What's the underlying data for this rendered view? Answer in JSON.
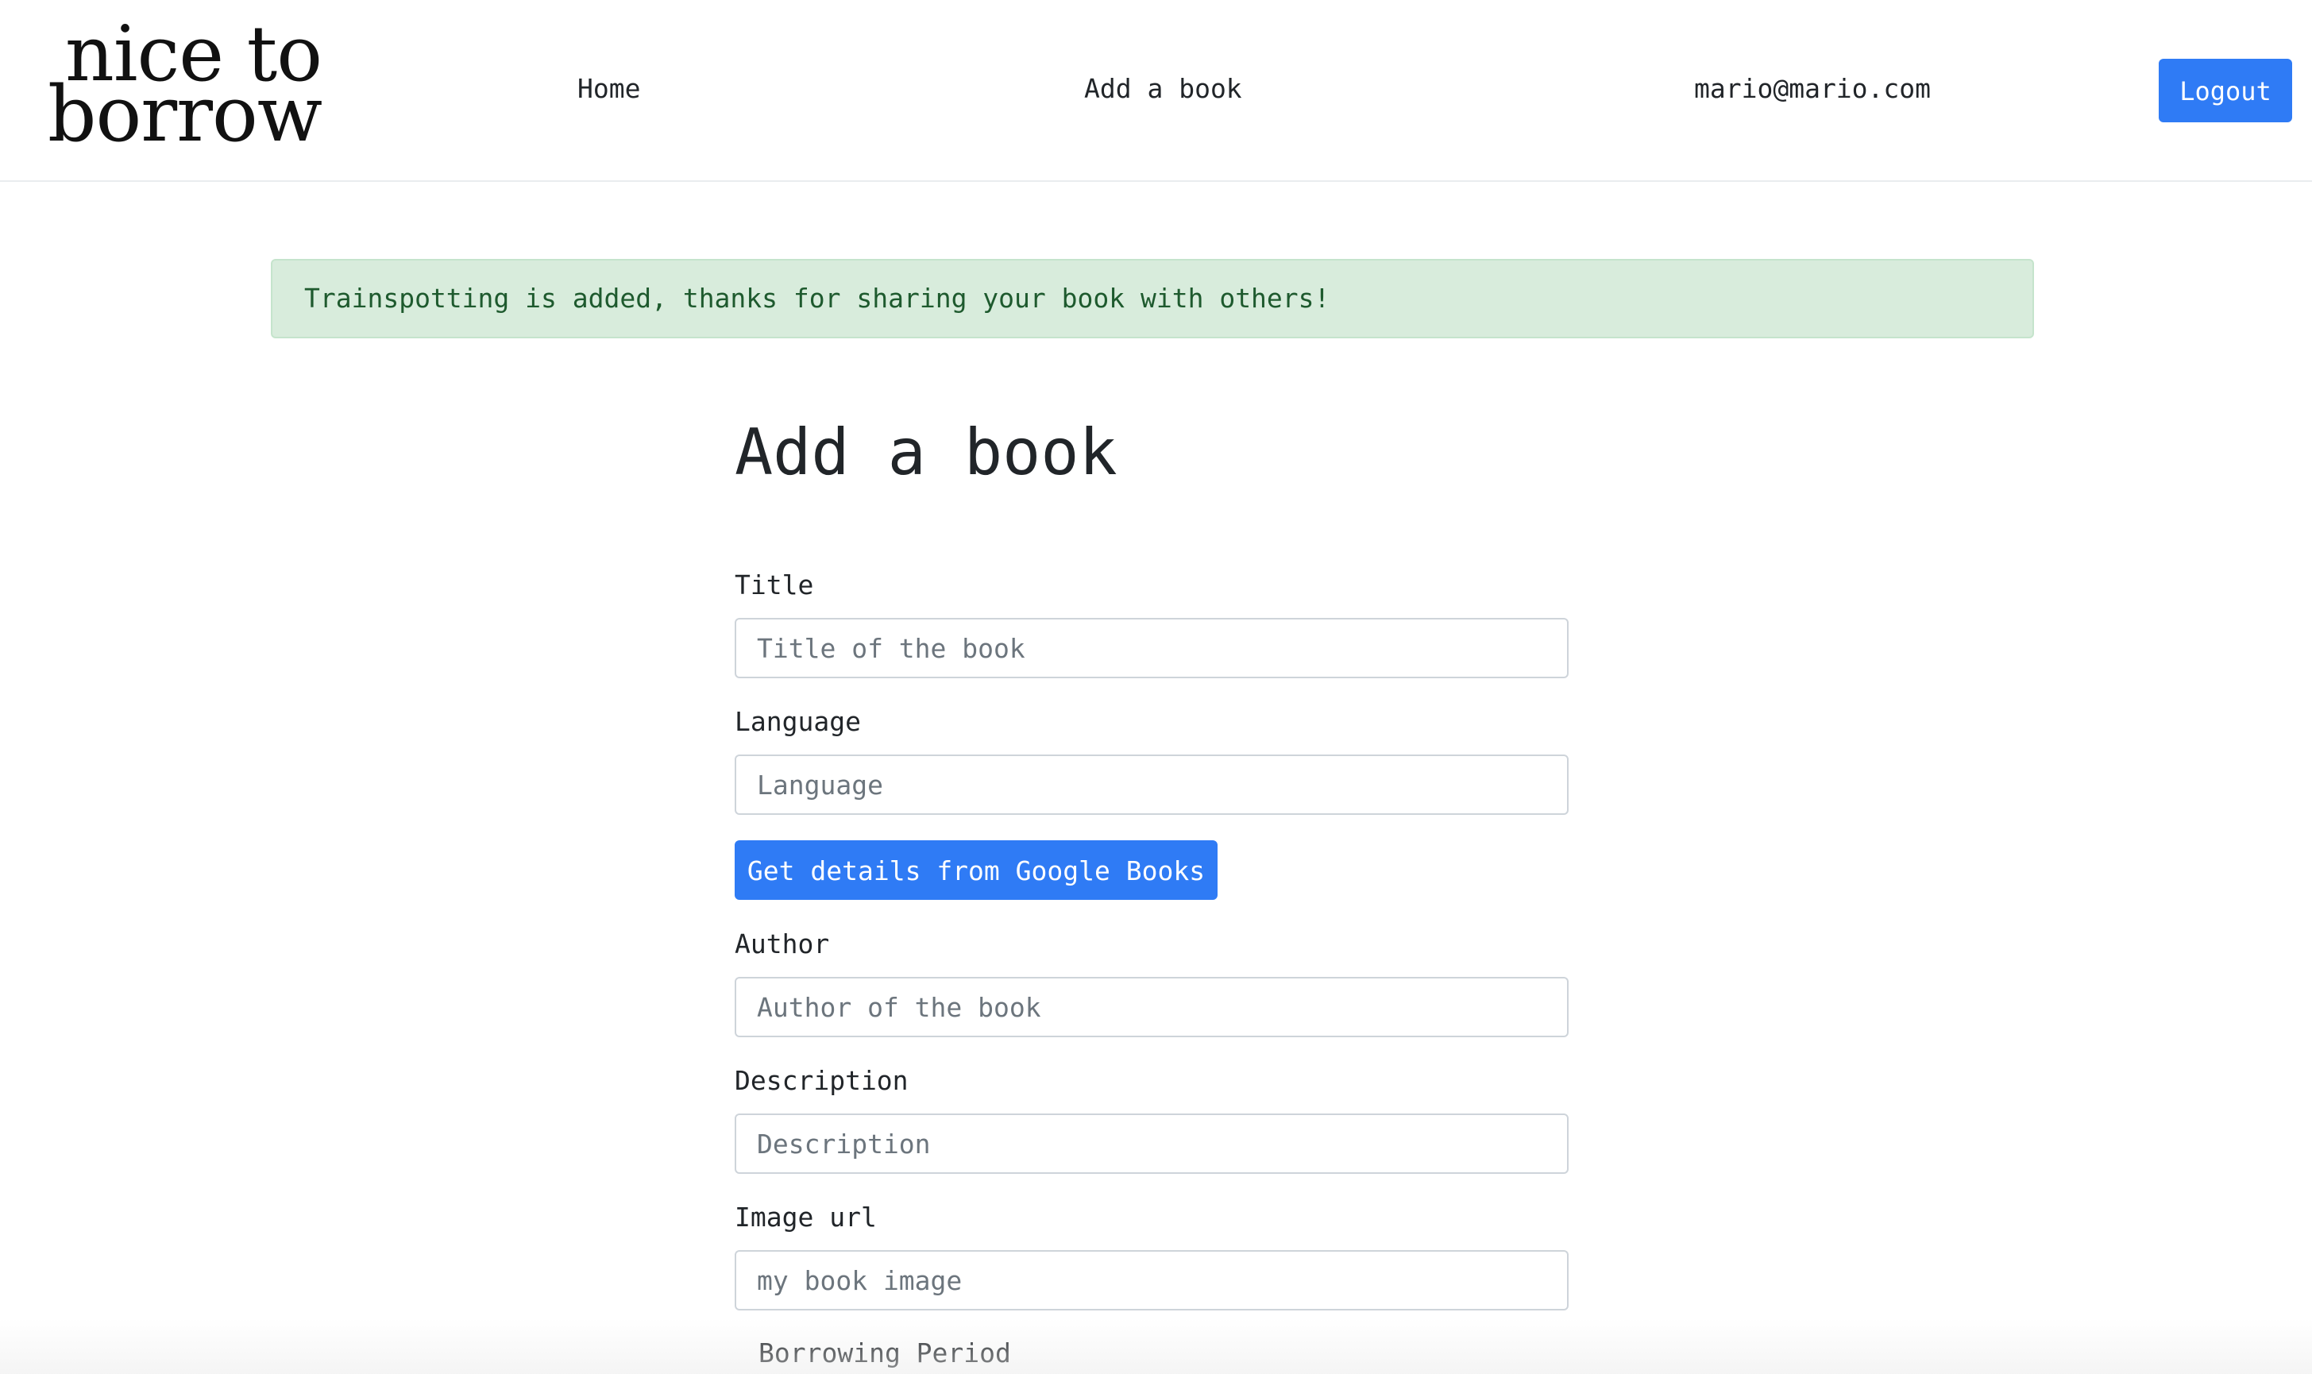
{
  "header": {
    "logo_line1": "nice to",
    "logo_line2": "borrow",
    "nav": {
      "home": "Home",
      "add_book": "Add a book",
      "user_email": "mario@mario.com"
    },
    "logout_label": "Logout"
  },
  "alert": {
    "message": "Trainspotting is added, thanks for sharing your book with others!",
    "type": "success"
  },
  "form": {
    "heading": "Add a book",
    "title": {
      "label": "Title",
      "placeholder": "Title of the book",
      "value": ""
    },
    "language": {
      "label": "Language",
      "placeholder": "Language",
      "value": ""
    },
    "google_button_label": "Get details from Google Books",
    "author": {
      "label": "Author",
      "placeholder": "Author of the book",
      "value": ""
    },
    "description": {
      "label": "Description",
      "placeholder": "Description",
      "value": ""
    },
    "image_url": {
      "label": "Image url",
      "placeholder": "my book image",
      "value": ""
    },
    "borrowing_period_label": "Borrowing Period"
  },
  "colors": {
    "primary": "#2f7bf5",
    "alert_bg": "#d8ecdc",
    "alert_text": "#1e5a2e",
    "input_border": "#ced4da"
  }
}
